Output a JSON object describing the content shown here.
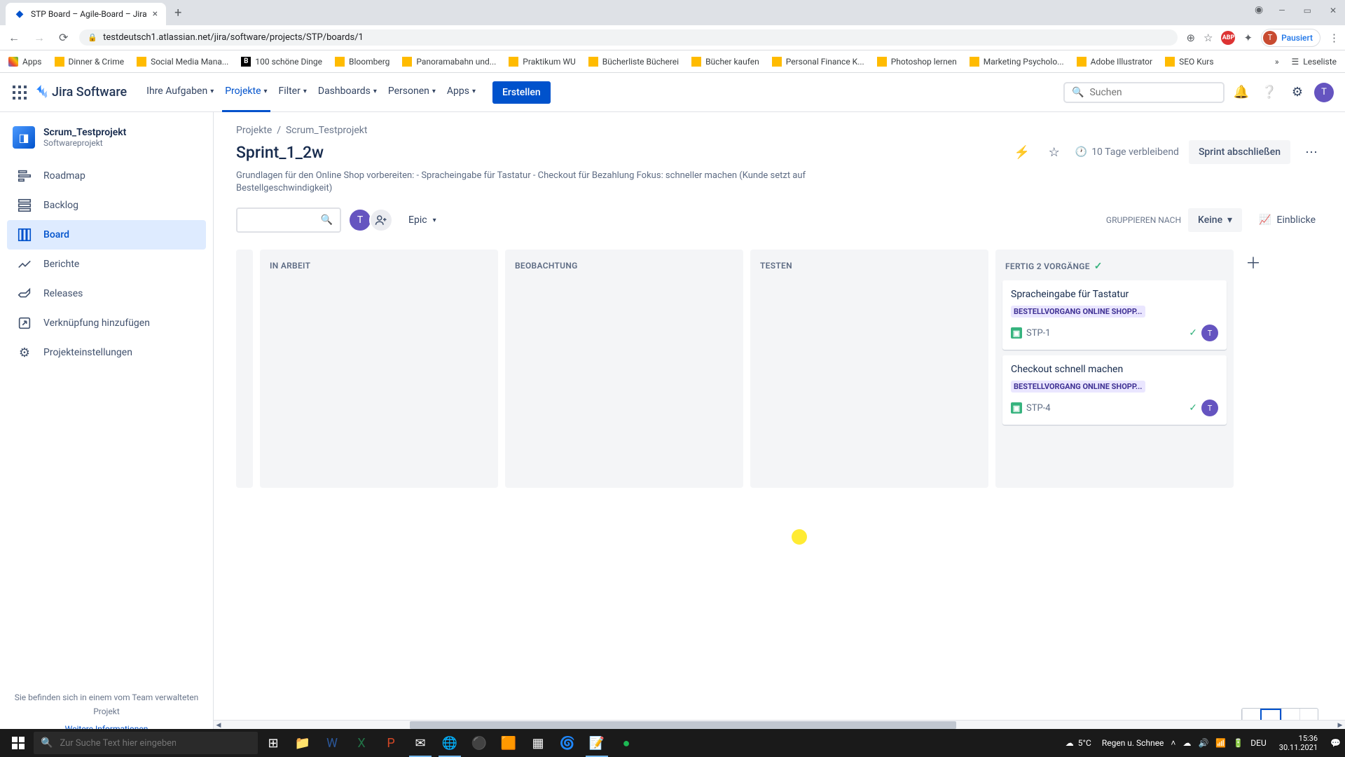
{
  "browser": {
    "tab_title": "STP Board – Agile-Board – Jira",
    "url": "testdeutsch1.atlassian.net/jira/software/projects/STP/boards/1",
    "profile_status": "Pausiert",
    "bookmarks": [
      "Apps",
      "Dinner & Crime",
      "Social Media Mana...",
      "100 schöne Dinge",
      "Bloomberg",
      "Panoramabahn und...",
      "Praktikum WU",
      "Bücherliste Bücherei",
      "Bücher kaufen",
      "Personal Finance K...",
      "Photoshop lernen",
      "Marketing Psycholo...",
      "Adobe Illustrator",
      "SEO Kurs"
    ],
    "reading_list": "Leseliste"
  },
  "jira_header": {
    "product": "Jira Software",
    "nav": {
      "aufgaben": "Ihre Aufgaben",
      "projekte": "Projekte",
      "filter": "Filter",
      "dashboards": "Dashboards",
      "personen": "Personen",
      "apps": "Apps"
    },
    "create": "Erstellen",
    "search_placeholder": "Suchen",
    "avatar_letter": "T"
  },
  "sidebar": {
    "project_name": "Scrum_Testprojekt",
    "project_type": "Softwareprojekt",
    "items": {
      "roadmap": "Roadmap",
      "backlog": "Backlog",
      "board": "Board",
      "berichte": "Berichte",
      "releases": "Releases",
      "link": "Verknüpfung hinzufügen",
      "settings": "Projekteinstellungen"
    },
    "footer_line": "Sie befinden sich in einem vom Team verwalteten Projekt",
    "footer_link": "Weitere Informationen"
  },
  "content": {
    "breadcrumb_projects": "Projekte",
    "breadcrumb_project": "Scrum_Testprojekt",
    "sprint_title": "Sprint_1_2w",
    "days_remaining": "10 Tage verbleibend",
    "complete_sprint": "Sprint abschließen",
    "description": "Grundlagen für den Online Shop vorbereiten: - Spracheingabe für Tastatur - Checkout für Bezahlung Fokus: schneller machen (Kunde setzt auf Bestellgeschwindigkeit)",
    "epic_label": "Epic",
    "group_by_label": "GRUPPIEREN NACH",
    "group_by_value": "Keine",
    "insights": "Einblicke",
    "columns": {
      "in_arbeit": "IN ARBEIT",
      "beobachtung": "BEOBACHTUNG",
      "testen": "TESTEN",
      "fertig": "FERTIG 2 VORGÄNGE"
    },
    "cards": [
      {
        "title": "Spracheingabe für Tastatur",
        "epic": "BESTELLVORGANG ONLINE SHOPP...",
        "key": "STP-1",
        "assignee": "T"
      },
      {
        "title": "Checkout schnell machen",
        "epic": "BESTELLVORGANG ONLINE SHOPP...",
        "key": "STP-4",
        "assignee": "T"
      }
    ]
  },
  "taskbar": {
    "search_placeholder": "Zur Suche Text hier eingeben",
    "weather_temp": "5°C",
    "weather_text": "Regen u. Schnee",
    "lang": "DEU",
    "time": "15:36",
    "date": "30.11.2021"
  }
}
